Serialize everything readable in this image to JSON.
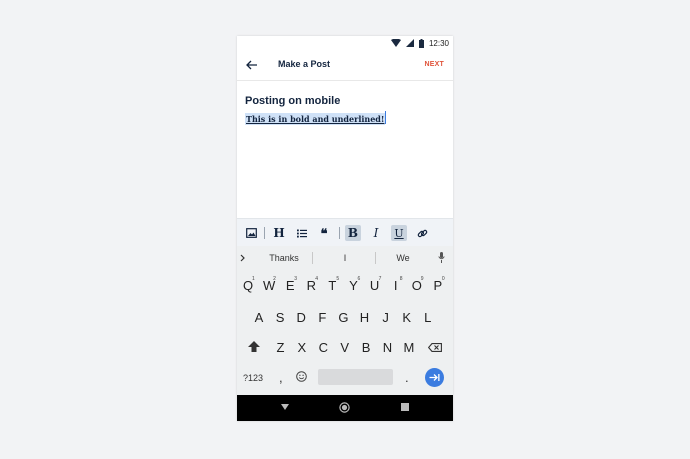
{
  "status": {
    "time": "12:30"
  },
  "appbar": {
    "title": "Make a Post",
    "next_label": "NEXT"
  },
  "editor": {
    "heading": "Posting on mobile",
    "body": "This is in bold and underlined!"
  },
  "toolbar": {
    "buttons": [
      {
        "name": "image-icon",
        "glyph": ""
      },
      {
        "name": "heading",
        "glyph": "H"
      },
      {
        "name": "bullet-list-icon",
        "glyph": ""
      },
      {
        "name": "quote-icon",
        "glyph": "❝"
      },
      {
        "name": "bold",
        "glyph": "B",
        "active": true
      },
      {
        "name": "italic",
        "glyph": "I",
        "active": false
      },
      {
        "name": "underline",
        "glyph": "U",
        "active": true
      },
      {
        "name": "link-icon",
        "glyph": ""
      }
    ]
  },
  "keyboard": {
    "suggestions": [
      "Thanks",
      "I",
      "We"
    ],
    "row1": [
      "Q",
      "W",
      "E",
      "R",
      "T",
      "Y",
      "U",
      "I",
      "O",
      "P"
    ],
    "row1_hints": [
      "1",
      "2",
      "3",
      "4",
      "5",
      "6",
      "7",
      "8",
      "9",
      "0"
    ],
    "row2": [
      "A",
      "S",
      "D",
      "F",
      "G",
      "H",
      "J",
      "K",
      "L"
    ],
    "row3": [
      "Z",
      "X",
      "C",
      "V",
      "B",
      "N",
      "M"
    ],
    "symbols_label": "?123",
    "comma_label": ",",
    "period_label": "."
  }
}
